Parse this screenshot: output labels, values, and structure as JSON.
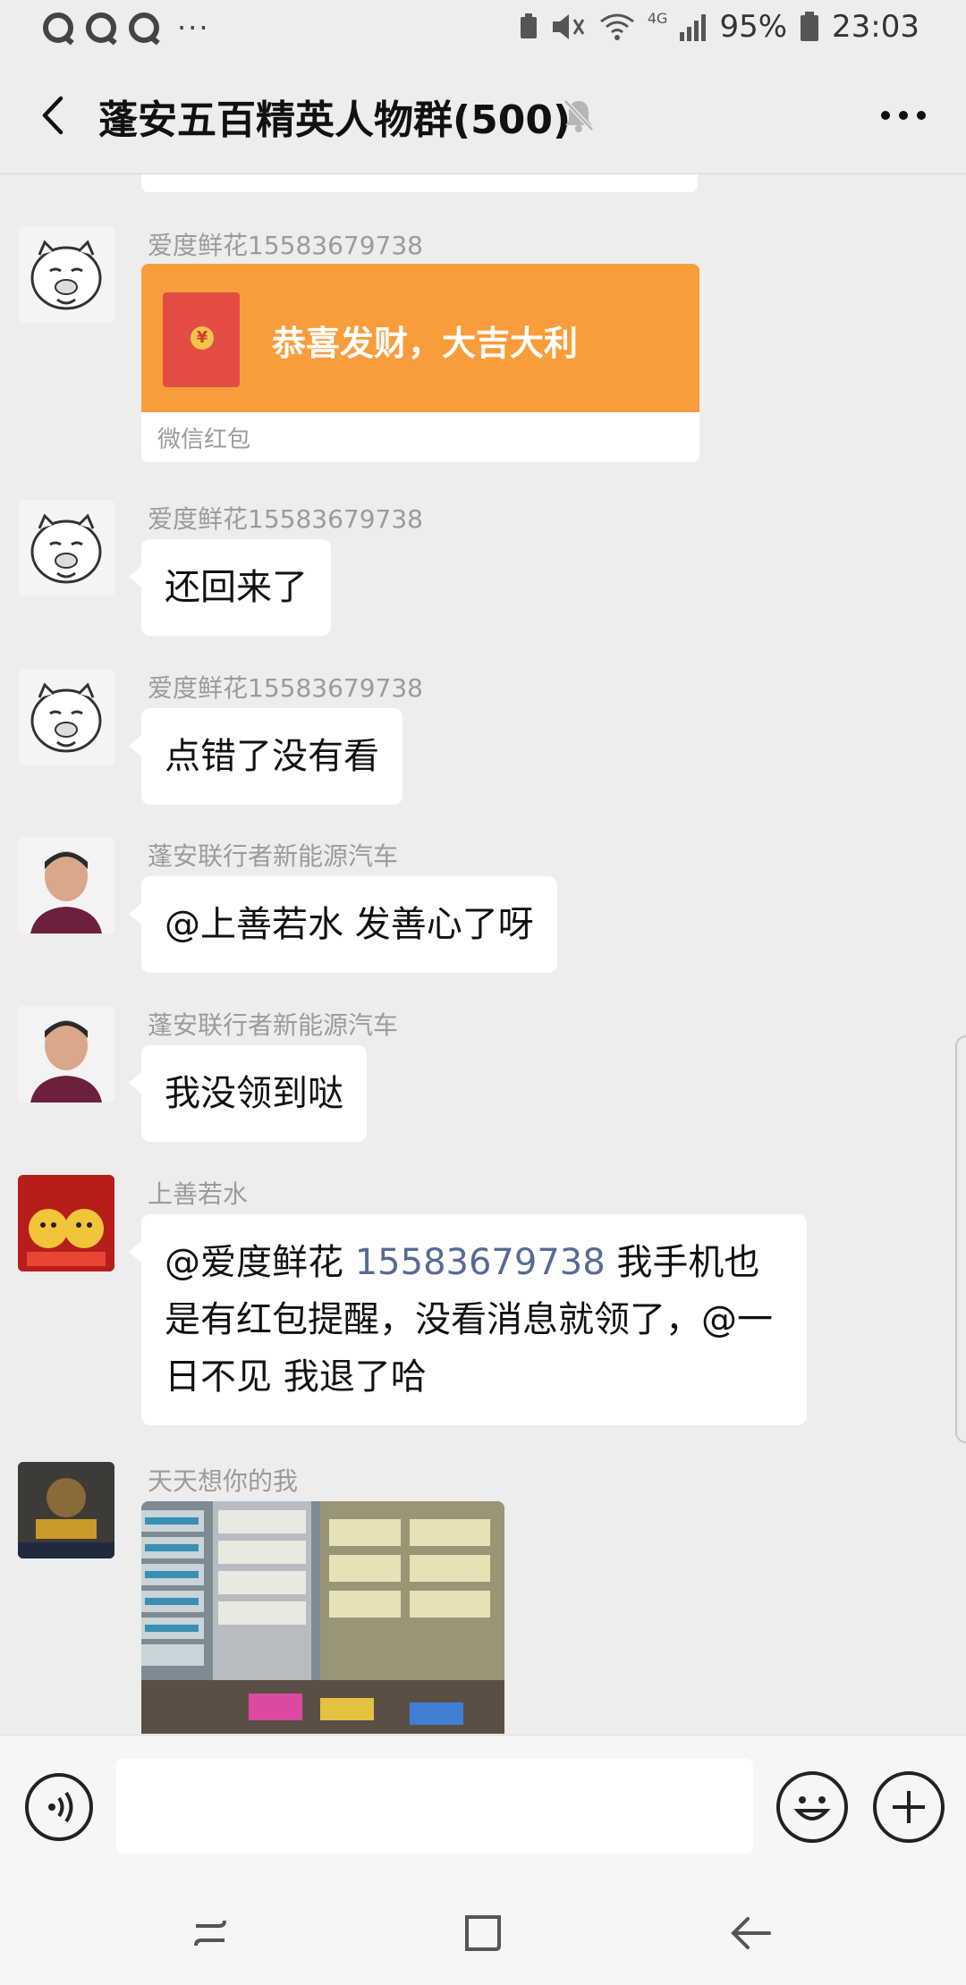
{
  "status_bar": {
    "battery": "95%",
    "time": "23:03",
    "network": "4G"
  },
  "header": {
    "title": "蓬安五百精英人物群(500)",
    "muted": true
  },
  "messages": [
    {
      "sender": "爱度鲜花15583679738",
      "type": "red_packet",
      "red_packet_text": "恭喜发财，大吉大利",
      "red_packet_label": "微信红包",
      "avatar_icon": "cartoon-pig-face"
    },
    {
      "sender": "爱度鲜花15583679738",
      "type": "text",
      "text": "还回来了",
      "avatar_icon": "cartoon-pig-face"
    },
    {
      "sender": "爱度鲜花15583679738",
      "type": "text",
      "text": "点错了没有看",
      "avatar_icon": "cartoon-pig-face"
    },
    {
      "sender": "蓬安联行者新能源汽车",
      "type": "text",
      "text": "@上善若水  发善心了呀",
      "avatar_icon": "man-portrait"
    },
    {
      "sender": "蓬安联行者新能源汽车",
      "type": "text",
      "text": "我没领到哒",
      "avatar_icon": "man-portrait"
    },
    {
      "sender": "上善若水",
      "type": "text_with_link",
      "text_prefix": "@爱度鲜花 ",
      "link_text": "15583679738",
      "text_suffix": " 我手机也是有红包提醒，没看消息就领了，@一日不见  我退了哈",
      "avatar_icon": "festive-dog-dolls"
    },
    {
      "sender": "天天想你的我",
      "type": "image",
      "image_icon": "store-shelves-photo",
      "avatar_icon": "game-character"
    }
  ],
  "input_bar": {
    "placeholder": "",
    "value": ""
  },
  "colors": {
    "background": "#ededed",
    "bubble": "#ffffff",
    "red_packet": "#f99d3c",
    "link": "#566b95",
    "sender_name": "#9b9b9b"
  }
}
